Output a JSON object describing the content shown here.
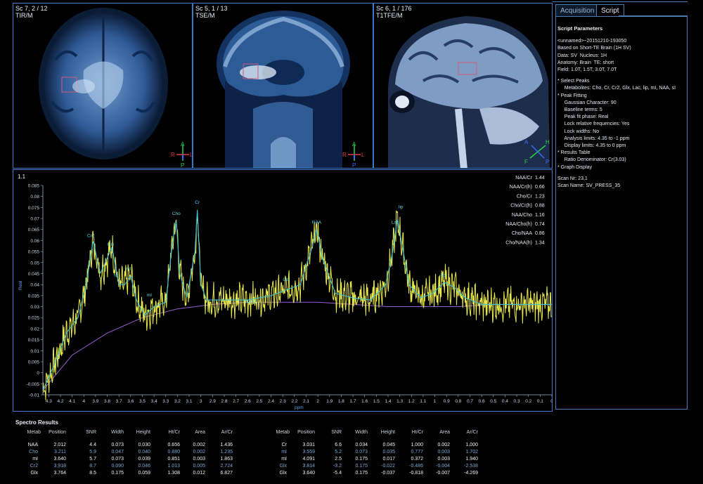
{
  "viewports": [
    {
      "label_line1": "Sc 7, 2 / 12",
      "label_line2": "TIR/M",
      "orient": {
        "top": "A",
        "left": "R",
        "right": "L",
        "bottom": "P"
      }
    },
    {
      "label_line1": "Sc 5, 1 / 13",
      "label_line2": "TSE/M",
      "orient": {
        "top": "A",
        "left": "R",
        "right": "L",
        "bottom": "P"
      }
    },
    {
      "label_line1": "Sc 6, 1 / 176",
      "label_line2": "T1TFE/M",
      "orient": {
        "top": "H",
        "left": "A",
        "right": "P",
        "bottom": "F"
      }
    }
  ],
  "tabs": {
    "acquisition": "Acquisition",
    "script": "Script"
  },
  "script_panel": {
    "title": "Script  Parameters",
    "lines": [
      "<unnamed>~20151210-193050",
      "Based on Short-TE Brain (1H SV)",
      "Data: SV  Nucleus: 1H",
      "Anatomy: Brain  TE: short",
      "Field: 1.0T, 1.5T, 3.0T, 7.0T",
      "",
      "* Select Peaks",
      "     Metabolites: Cho, Cr, Cr2, Glx, Lac, lip, mI, NAA, sI",
      "* Peak Fitting",
      "     Gaussian Character: 90",
      "     Baseline terms: 5",
      "     Peak fit phase: Real",
      "     Lock relative frequencies: Yes",
      "     Lock widths: No",
      "     Analysis limits: 4.35 to -1 ppm",
      "     Display limits: 4.35 to 0 ppm",
      "* Results Table",
      "     Ratio Denominator: Cr(3.03)",
      "* Graph Display",
      "",
      "Scan Nr: 23,1",
      "Scan Name: SV_PRESS_35"
    ]
  },
  "spectrum": {
    "panel_label": "1.1",
    "ratios": [
      {
        "name": "NAA/Cr",
        "value": "1.44"
      },
      {
        "name": "NAA/Cr(h)",
        "value": "0.66"
      },
      {
        "name": "Cho/Cr",
        "value": "1.23"
      },
      {
        "name": "Cho/Cr(h)",
        "value": "0.88"
      },
      {
        "name": "NAA/Cho",
        "value": "1.16"
      },
      {
        "name": "NAA/Cho(h)",
        "value": "0.74"
      },
      {
        "name": "Cho/NAA",
        "value": "0.86"
      },
      {
        "name": "Cho/NAA(h)",
        "value": "1.34"
      }
    ],
    "colors": {
      "raw": "#e8e84a",
      "fit": "#3ec3d8",
      "baseline": "#9a5fd6",
      "axis": "#9fb3c8",
      "label": "#5ed6e6"
    }
  },
  "chart_data": {
    "type": "line",
    "title": "",
    "xlabel": "ppm",
    "ylabel": "Real",
    "xlim": [
      4.35,
      0
    ],
    "ylim": [
      -0.01,
      0.085
    ],
    "x_ticks": [
      "4.3",
      "4.2",
      "4.1",
      "4",
      "3.9",
      "3.8",
      "3.7",
      "3.6",
      "3.5",
      "3.4",
      "3.3",
      "3.2",
      "3.1",
      "3",
      "2.9",
      "2.8",
      "2.7",
      "2.6",
      "2.5",
      "2.4",
      "2.3",
      "2.2",
      "2.1",
      "2",
      "1.9",
      "1.8",
      "1.7",
      "1.6",
      "1.5",
      "1.4",
      "1.3",
      "1.2",
      "1.1",
      "1",
      "0.9",
      "0.8",
      "0.7",
      "0.6",
      "0.5",
      "0.4",
      "0.3",
      "0.2",
      "0.1",
      "0"
    ],
    "y_ticks": [
      "0.085",
      "0.08",
      "0.075",
      "0.07",
      "0.065",
      "0.06",
      "0.055",
      "0.05",
      "0.045",
      "0.04",
      "0.035",
      "0.03",
      "0.025",
      "0.02",
      "0.015",
      "0.01",
      "0.005",
      "0",
      "-0.005",
      "-0.01"
    ],
    "baseline_points": [
      [
        4.35,
        -0.008
      ],
      [
        4.1,
        0.008
      ],
      [
        3.8,
        0.018
      ],
      [
        3.5,
        0.025
      ],
      [
        3.2,
        0.029
      ],
      [
        2.9,
        0.031
      ],
      [
        2.6,
        0.032
      ],
      [
        2.3,
        0.032
      ],
      [
        2.0,
        0.032
      ],
      [
        1.7,
        0.031
      ],
      [
        1.4,
        0.03
      ],
      [
        1.1,
        0.03
      ],
      [
        0.8,
        0.03
      ],
      [
        0.5,
        0.031
      ],
      [
        0.2,
        0.031
      ],
      [
        0.0,
        0.031
      ]
    ],
    "fit_points": [
      [
        4.35,
        -0.008
      ],
      [
        4.25,
        0.004
      ],
      [
        4.15,
        0.018
      ],
      [
        4.05,
        0.025
      ],
      [
        3.98,
        0.04
      ],
      [
        3.92,
        0.06
      ],
      [
        3.86,
        0.045
      ],
      [
        3.8,
        0.052
      ],
      [
        3.76,
        0.057
      ],
      [
        3.7,
        0.04
      ],
      [
        3.65,
        0.04
      ],
      [
        3.6,
        0.044
      ],
      [
        3.55,
        0.033
      ],
      [
        3.48,
        0.026
      ],
      [
        3.4,
        0.03
      ],
      [
        3.3,
        0.032
      ],
      [
        3.24,
        0.06
      ],
      [
        3.21,
        0.069
      ],
      [
        3.18,
        0.045
      ],
      [
        3.12,
        0.034
      ],
      [
        3.05,
        0.055
      ],
      [
        3.03,
        0.074
      ],
      [
        3.0,
        0.04
      ],
      [
        2.95,
        0.033
      ],
      [
        2.8,
        0.033
      ],
      [
        2.6,
        0.033
      ],
      [
        2.4,
        0.035
      ],
      [
        2.25,
        0.038
      ],
      [
        2.15,
        0.04
      ],
      [
        2.06,
        0.055
      ],
      [
        2.01,
        0.065
      ],
      [
        1.96,
        0.052
      ],
      [
        1.85,
        0.036
      ],
      [
        1.7,
        0.034
      ],
      [
        1.55,
        0.033
      ],
      [
        1.42,
        0.04
      ],
      [
        1.36,
        0.055
      ],
      [
        1.32,
        0.07
      ],
      [
        1.28,
        0.058
      ],
      [
        1.22,
        0.04
      ],
      [
        1.12,
        0.034
      ],
      [
        1.02,
        0.036
      ],
      [
        0.92,
        0.041
      ],
      [
        0.84,
        0.039
      ],
      [
        0.74,
        0.034
      ],
      [
        0.6,
        0.031
      ],
      [
        0.4,
        0.031
      ],
      [
        0.2,
        0.031
      ],
      [
        0.0,
        0.031
      ]
    ],
    "raw_note_series": "Real",
    "peak_labels": [
      {
        "label": "Cr2",
        "x": 3.94,
        "y": 0.061
      },
      {
        "label": "Glx",
        "x": 3.77,
        "y": 0.057
      },
      {
        "label": "mI",
        "x": 3.62,
        "y": 0.046
      },
      {
        "label": "sI",
        "x": 3.73,
        "y": 0.043
      },
      {
        "label": "mI",
        "x": 3.44,
        "y": 0.034
      },
      {
        "label": "Cho",
        "x": 3.21,
        "y": 0.071
      },
      {
        "label": "Cr",
        "x": 3.03,
        "y": 0.076
      },
      {
        "label": "NAA1",
        "x": 2.57,
        "y": 0.031
      },
      {
        "label": "Glx",
        "x": 2.27,
        "y": 0.041
      },
      {
        "label": "NAA",
        "x": 2.01,
        "y": 0.067
      },
      {
        "label": "lip",
        "x": 1.29,
        "y": 0.074
      },
      {
        "label": "Lac",
        "x": 1.34,
        "y": 0.067
      },
      {
        "label": "lip",
        "x": 0.93,
        "y": 0.043
      }
    ]
  },
  "results": {
    "title": "Spectro Results",
    "headers": [
      "Metab",
      "Position",
      "SNR",
      "Width",
      "Height",
      "Ht/Cr",
      "Area",
      "Ar/Cr"
    ],
    "left_rows": [
      [
        "NAA",
        "2.012",
        "4.4",
        "0.073",
        "0.030",
        "0.656",
        "0.002",
        "1.436"
      ],
      [
        "Cho",
        "3.211",
        "5.9",
        "0.047",
        "0.040",
        "0.880",
        "0.002",
        "1.235"
      ],
      [
        "mI",
        "3.640",
        "5.7",
        "0.073",
        "0.039",
        "0.851",
        "0.003",
        "1.863"
      ],
      [
        "Cr2",
        "3.918",
        "8.7",
        "0.090",
        "0.046",
        "1.013",
        "0.005",
        "2.724"
      ],
      [
        "Glx",
        "3.764",
        "8.5",
        "0.175",
        "0.059",
        "1.308",
        "0.012",
        "6.827"
      ]
    ],
    "right_rows": [
      [
        "Cr",
        "3.031",
        "6.6",
        "0.034",
        "0.045",
        "1.000",
        "0.002",
        "1.000"
      ],
      [
        "mI",
        "3.559",
        "5.2",
        "0.073",
        "0.035",
        "0.777",
        "0.003",
        "1.702"
      ],
      [
        "mI",
        "4.091",
        "2.5",
        "0.175",
        "0.017",
        "0.372",
        "0.003",
        "1.940"
      ],
      [
        "Glx",
        "3.814",
        "-3.2",
        "0.175",
        "-0.022",
        "-0.486",
        "-0.004",
        "-2.538"
      ],
      [
        "Glx",
        "3.640",
        "-5.4",
        "0.175",
        "-0.037",
        "-0.818",
        "-0.007",
        "-4.269"
      ]
    ],
    "row_colors": [
      "w",
      "b",
      "w",
      "b",
      "w"
    ]
  }
}
